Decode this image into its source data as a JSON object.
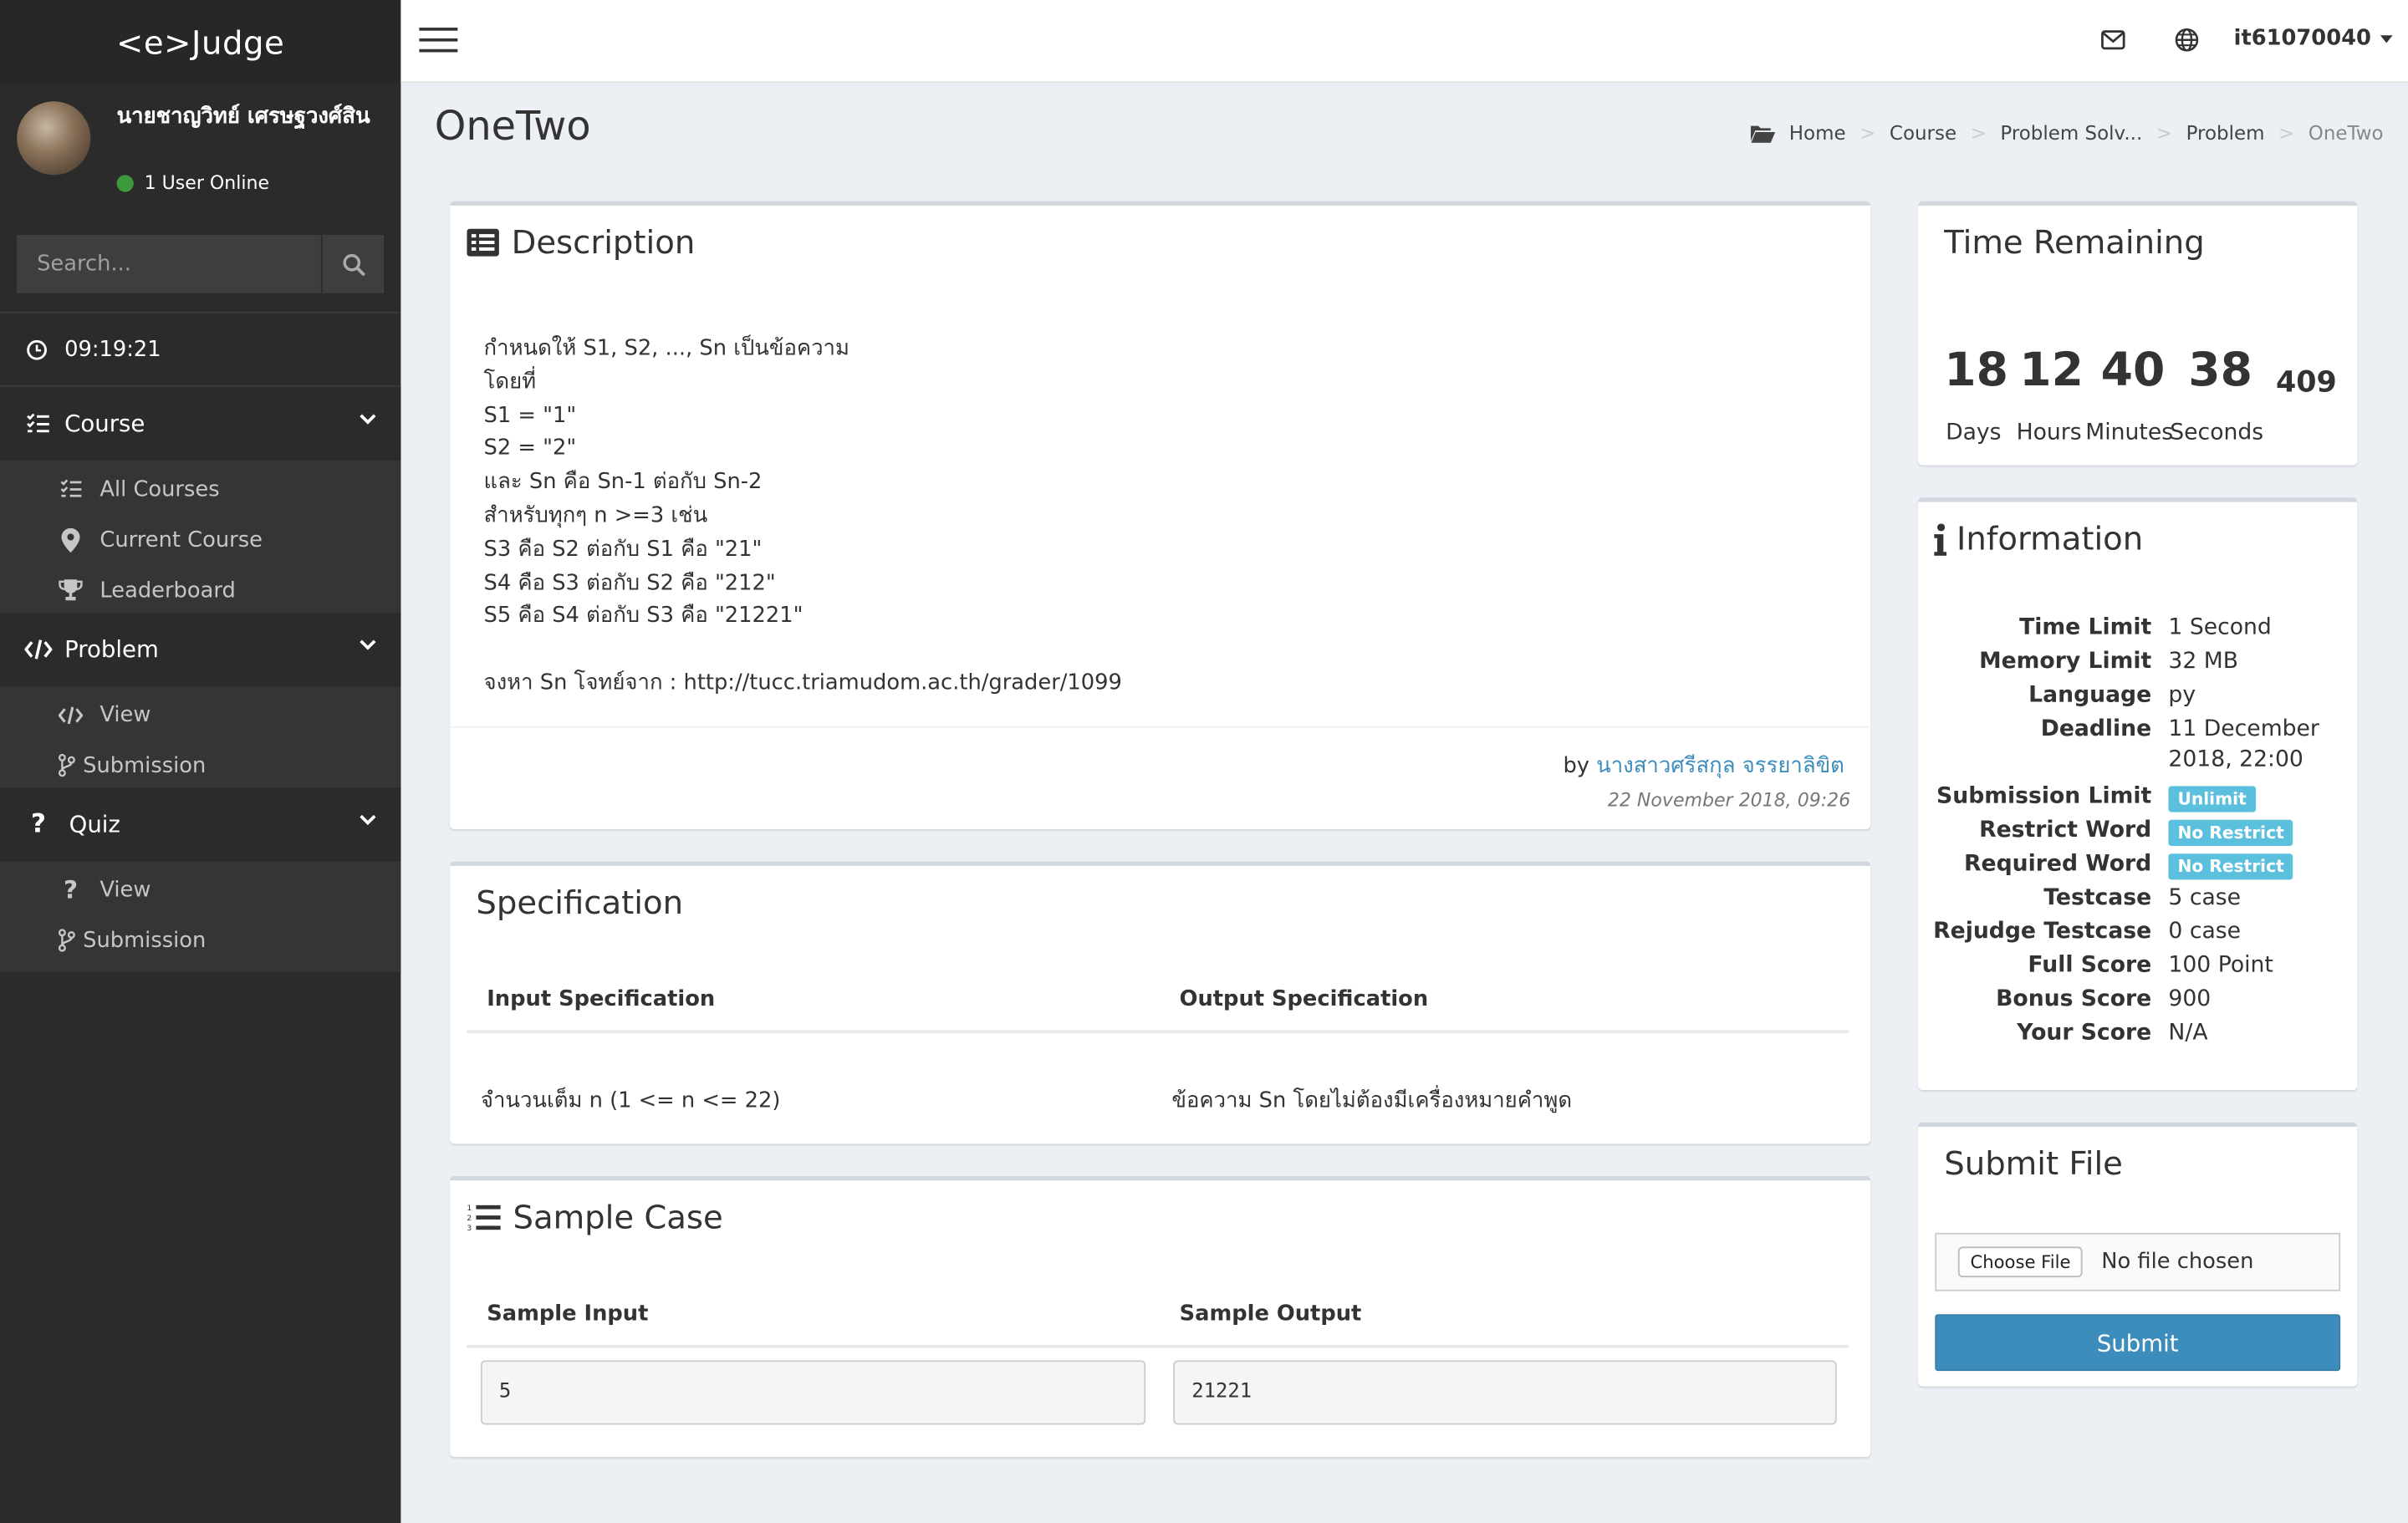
{
  "app": {
    "logo": "<e>Judge"
  },
  "user": {
    "name": "นายชาญวิทย์ เศรษฐวงศ์สิน",
    "status": "1 User Online",
    "username": "it61070040"
  },
  "search": {
    "placeholder": "Search..."
  },
  "clock": "09:19:21",
  "menu": {
    "course": {
      "label": "Course",
      "items": [
        "All Courses",
        "Current Course",
        "Leaderboard"
      ]
    },
    "problem": {
      "label": "Problem",
      "items": [
        "View",
        "Submission"
      ]
    },
    "quiz": {
      "label": "Quiz",
      "items": [
        "View",
        "Submission"
      ]
    }
  },
  "page": {
    "title": "OneTwo"
  },
  "breadcrumb": [
    "Home",
    "Course",
    "Problem Solv...",
    "Problem",
    "OneTwo"
  ],
  "description": {
    "title": "Description",
    "lines": [
      "กำหนดให้ S1, S2, ..., Sn เป็นข้อความ",
      "โดยที่",
      "S1 = \"1\"",
      "S2 = \"2\"",
      "และ Sn คือ Sn-1 ต่อกับ Sn-2",
      "สำหรับทุกๆ n >=3 เช่น",
      "S3 คือ S2 ต่อกับ S1 คือ \"21\"",
      "S4 คือ S3 ต่อกับ S2 คือ \"212\"",
      "S5 คือ S4 ต่อกับ S3 คือ \"21221\"",
      "",
      "จงหา Sn โจทย์จาก : http://tucc.triamudom.ac.th/grader/1099"
    ],
    "by_label": "by",
    "author": "นางสาวศรีสกุล จรรยาลิขิต",
    "date": "22 November 2018, 09:26"
  },
  "specification": {
    "title": "Specification",
    "input_header": "Input Specification",
    "output_header": "Output Specification",
    "input": "จำนวนเต็ม n (1 <= n <= 22)",
    "output": "ข้อความ Sn โดยไม่ต้องมีเครื่องหมายคำพูด"
  },
  "sample": {
    "title": "Sample Case",
    "input_header": "Sample Input",
    "output_header": "Sample Output",
    "input": "5",
    "output": "21221"
  },
  "timer": {
    "title": "Time Remaining",
    "days": "18",
    "hours": "12",
    "minutes": "40",
    "seconds": "38",
    "ms": "409",
    "labels": [
      "Days",
      "Hours",
      "Minutes",
      "Seconds"
    ]
  },
  "info": {
    "title": "Information",
    "rows": [
      {
        "k": "Time Limit",
        "v": "1 Second"
      },
      {
        "k": "Memory Limit",
        "v": "32 MB"
      },
      {
        "k": "Language",
        "v": "py"
      },
      {
        "k": "Deadline",
        "v": "11 December",
        "v2": "2018, 22:00"
      },
      {
        "k": "Submission Limit",
        "badge": "Unlimit"
      },
      {
        "k": "Restrict Word",
        "badge": "No Restrict"
      },
      {
        "k": "Required Word",
        "badge": "No Restrict"
      },
      {
        "k": "Testcase",
        "v": "5 case"
      },
      {
        "k": "Rejudge Testcase",
        "v": "0 case"
      },
      {
        "k": "Full Score",
        "v": "100 Point"
      },
      {
        "k": "Bonus Score",
        "v": "900"
      },
      {
        "k": "Your Score",
        "v": "N/A"
      }
    ]
  },
  "submit": {
    "title": "Submit File",
    "choose_label": "Choose File",
    "no_file": "No file chosen",
    "button": "Submit"
  },
  "colors": {
    "sidebar": "#2b2b2b",
    "accent": "#3c8dbc",
    "badge": "#5bc0de",
    "page_bg": "#ecf0f5"
  }
}
